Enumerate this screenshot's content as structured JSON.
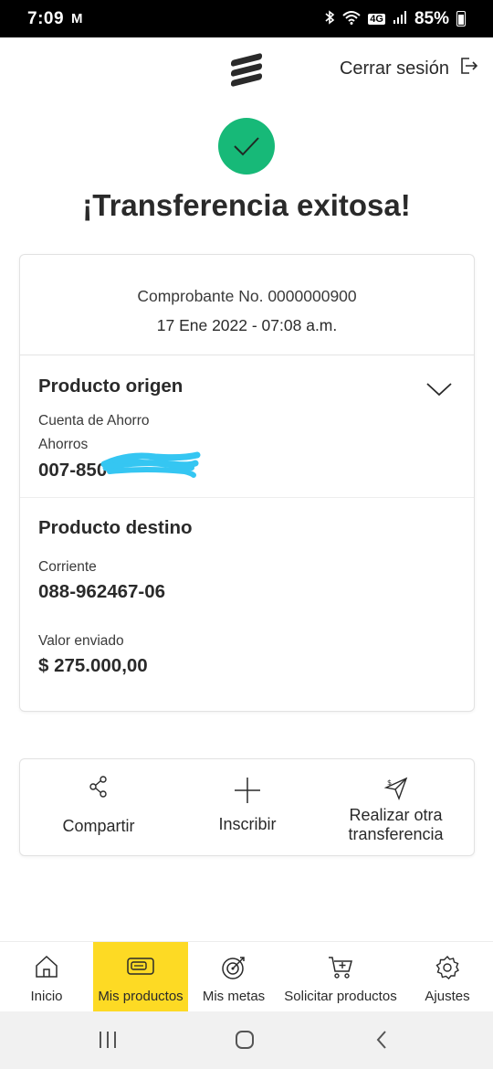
{
  "status_bar": {
    "time": "7:09",
    "mail_glyph": "M",
    "battery": "85%",
    "network": "4G"
  },
  "header": {
    "logout_label": "Cerrar sesión"
  },
  "success": {
    "title": "¡Transferencia exitosa!",
    "color": "#17b978"
  },
  "receipt": {
    "number_label": "Comprobante No. 0000000900",
    "date": "17 Ene 2022 - 07:08 a.m."
  },
  "origin": {
    "title": "Producto origen",
    "account_type": "Cuenta de Ahorro",
    "account_subtype": "Ahorros",
    "account_number": "007-850"
  },
  "destination": {
    "title": "Producto destino",
    "account_type": "Corriente",
    "account_number": "088-962467-06",
    "amount_label": "Valor enviado",
    "amount": "$ 275.000,00"
  },
  "actions": {
    "share_label": "Compartir",
    "enroll_label": "Inscribir",
    "another_line1": "Realizar otra",
    "another_line2": "transferencia"
  },
  "nav": {
    "items": [
      {
        "label": "Inicio",
        "icon": "home-icon"
      },
      {
        "label": "Mis productos",
        "icon": "wallet-icon",
        "active": true
      },
      {
        "label": "Mis metas",
        "icon": "target-icon"
      },
      {
        "label": "Solicitar productos",
        "icon": "cart-plus-icon"
      },
      {
        "label": "Ajustes",
        "icon": "gear-icon"
      }
    ],
    "active_color": "#fdda24"
  }
}
